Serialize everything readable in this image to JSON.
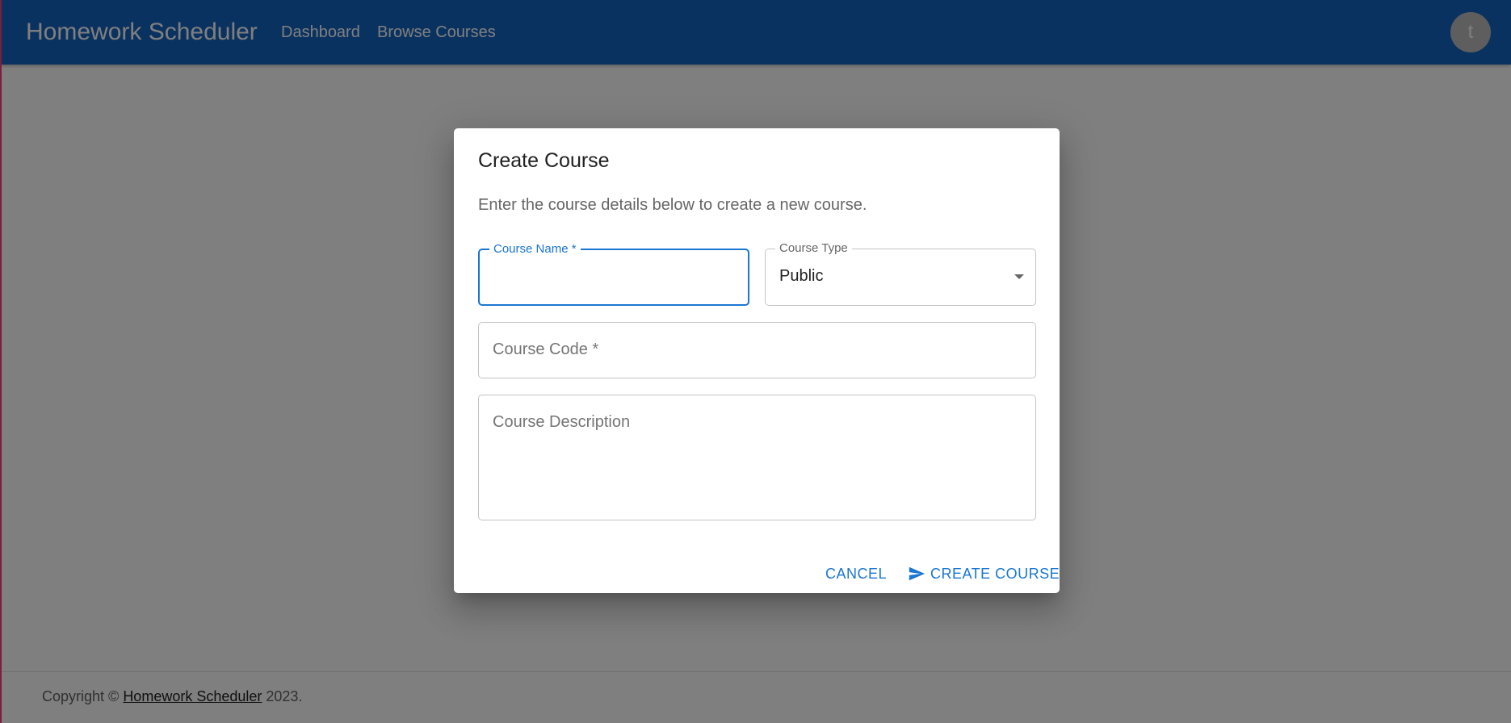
{
  "appbar": {
    "brand": "Homework Scheduler",
    "nav": {
      "dashboard": "Dashboard",
      "browse_courses": "Browse Courses"
    },
    "avatar_initial": "t",
    "color": "#1565c0"
  },
  "dialog": {
    "title": "Create Course",
    "description": "Enter the course details below to create a new course.",
    "fields": {
      "course_name": {
        "label": "Course Name *",
        "value": ""
      },
      "course_type": {
        "label": "Course Type",
        "value": "Public"
      },
      "course_code": {
        "label": "Course Code *",
        "value": ""
      },
      "course_description": {
        "label": "Course Description",
        "value": ""
      }
    },
    "actions": {
      "cancel": "Cancel",
      "create": "Create Course"
    },
    "accent_color": "#1976d2"
  },
  "footer": {
    "prefix": "Copyright © ",
    "link": "Homework Scheduler",
    "suffix": " 2023."
  },
  "icons": {
    "create_button_icon": "send-icon",
    "course_type_dropdown": "arrow-drop-down-icon"
  }
}
